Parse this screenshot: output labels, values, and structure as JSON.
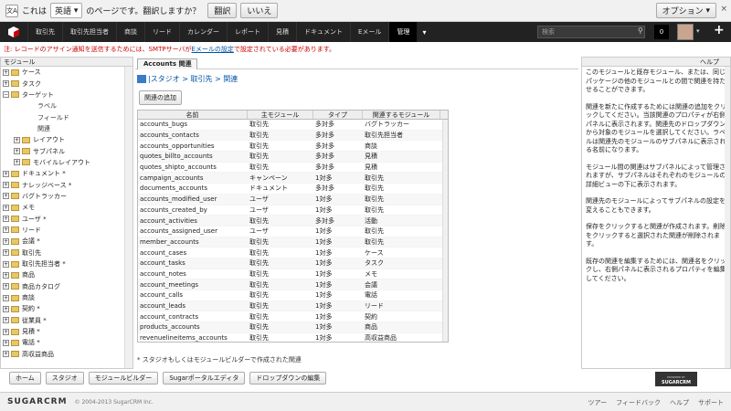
{
  "translate_bar": {
    "prefix": "これは",
    "language": "英語",
    "suffix": "のページです。翻訳しますか？",
    "translate_button": "翻訳",
    "no_button": "いいえ",
    "options_button": "オプション",
    "close": "×"
  },
  "nav": {
    "items": [
      "取引先",
      "取引先担当者",
      "商談",
      "リード",
      "カレンダー",
      "レポート",
      "見積",
      "ドキュメント",
      "Eメール",
      "管理"
    ],
    "active_index": 9,
    "more": "▾",
    "search_placeholder": "検索",
    "notifications": "0",
    "plus": "+"
  },
  "warning": {
    "before": "注: レコードのアサイン通知を送信するためには、SMTPサーバが",
    "link": "Eメールの設定",
    "after": "で設定されている必要があります。"
  },
  "left": {
    "title": "モジュール",
    "tree": [
      {
        "label": "ケース",
        "exp": "+",
        "indent": 0,
        "folder": true
      },
      {
        "label": "タスク",
        "exp": "+",
        "indent": 0,
        "folder": true
      },
      {
        "label": "ターゲット",
        "exp": "−",
        "indent": 0,
        "folder": true
      },
      {
        "label": "ラベル",
        "exp": "",
        "indent": 1,
        "folder": false
      },
      {
        "label": "フィールド",
        "exp": "",
        "indent": 1,
        "folder": false
      },
      {
        "label": "関連",
        "exp": "",
        "indent": 1,
        "folder": false
      },
      {
        "label": "レイアウト",
        "exp": "+",
        "indent": 1,
        "folder": true
      },
      {
        "label": "サブパネル",
        "exp": "+",
        "indent": 1,
        "folder": true
      },
      {
        "label": "モバイルレイアウト",
        "exp": "+",
        "indent": 1,
        "folder": true
      },
      {
        "label": "ドキュメント *",
        "exp": "+",
        "indent": 0,
        "folder": true
      },
      {
        "label": "ナレッジベース *",
        "exp": "+",
        "indent": 0,
        "folder": true
      },
      {
        "label": "バグトラッカー",
        "exp": "+",
        "indent": 0,
        "folder": true
      },
      {
        "label": "メモ",
        "exp": "+",
        "indent": 0,
        "folder": true
      },
      {
        "label": "ユーザ *",
        "exp": "+",
        "indent": 0,
        "folder": true
      },
      {
        "label": "リード",
        "exp": "+",
        "indent": 0,
        "folder": true
      },
      {
        "label": "会議 *",
        "exp": "+",
        "indent": 0,
        "folder": true
      },
      {
        "label": "取引先",
        "exp": "+",
        "indent": 0,
        "folder": true
      },
      {
        "label": "取引先担当者 *",
        "exp": "+",
        "indent": 0,
        "folder": true
      },
      {
        "label": "商品",
        "exp": "+",
        "indent": 0,
        "folder": true
      },
      {
        "label": "商品カタログ",
        "exp": "+",
        "indent": 0,
        "folder": true
      },
      {
        "label": "商談",
        "exp": "+",
        "indent": 0,
        "folder": true
      },
      {
        "label": "契約 *",
        "exp": "+",
        "indent": 0,
        "folder": true
      },
      {
        "label": "従業員 *",
        "exp": "+",
        "indent": 0,
        "folder": true
      },
      {
        "label": "見積 *",
        "exp": "+",
        "indent": 0,
        "folder": true
      },
      {
        "label": "電話 *",
        "exp": "+",
        "indent": 0,
        "folder": true
      },
      {
        "label": "高収益商品",
        "exp": "+",
        "indent": 0,
        "folder": true
      }
    ]
  },
  "center": {
    "tab": "Accounts 関連",
    "breadcrumb": "|スタジオ > 取引先 > 関連",
    "add_button": "関連の追加",
    "columns": [
      "名前",
      "主モジュール",
      "タイプ",
      "関連するモジュール"
    ],
    "rows": [
      [
        "accounts_bugs",
        "取引先",
        "多対多",
        "バグトラッカー"
      ],
      [
        "accounts_contacts",
        "取引先",
        "多対多",
        "取引先担当者"
      ],
      [
        "accounts_opportunities",
        "取引先",
        "多対多",
        "商談"
      ],
      [
        "quotes_billto_accounts",
        "取引先",
        "多対多",
        "見積"
      ],
      [
        "quotes_shipto_accounts",
        "取引先",
        "多対多",
        "見積"
      ],
      [
        "campaign_accounts",
        "キャンペーン",
        "1対多",
        "取引先"
      ],
      [
        "documents_accounts",
        "ドキュメント",
        "多対多",
        "取引先"
      ],
      [
        "accounts_modified_user",
        "ユーザ",
        "1対多",
        "取引先"
      ],
      [
        "accounts_created_by",
        "ユーザ",
        "1対多",
        "取引先"
      ],
      [
        "account_activities",
        "取引先",
        "多対多",
        "活動"
      ],
      [
        "accounts_assigned_user",
        "ユーザ",
        "1対多",
        "取引先"
      ],
      [
        "member_accounts",
        "取引先",
        "1対多",
        "取引先"
      ],
      [
        "account_cases",
        "取引先",
        "1対多",
        "ケース"
      ],
      [
        "account_tasks",
        "取引先",
        "1対多",
        "タスク"
      ],
      [
        "account_notes",
        "取引先",
        "1対多",
        "メモ"
      ],
      [
        "account_meetings",
        "取引先",
        "1対多",
        "会議"
      ],
      [
        "account_calls",
        "取引先",
        "1対多",
        "電話"
      ],
      [
        "account_leads",
        "取引先",
        "1対多",
        "リード"
      ],
      [
        "account_contracts",
        "取引先",
        "1対多",
        "契約"
      ],
      [
        "products_accounts",
        "取引先",
        "1対多",
        "商品"
      ],
      [
        "revenuelineitems_accounts",
        "取引先",
        "1対多",
        "高収益商品"
      ]
    ],
    "footnote": "* スタジオもしくはモジュールビルダーで作成された関連"
  },
  "help": {
    "title": "ヘルプ",
    "paragraphs": [
      "このモジュールと既存モジュール、または、同じパッケージの他のモジュールとの間で関連を持たせることができます。",
      "関連を新たに作成するためには関連の追加をクリックしてください。当該関連のプロパティが右側パネルに表示されます。関連先のドロップダウンから対象のモジュールを選択してください。ラベルは関連先のモジュールのサブパネルに表示される名前になります。",
      "モジュール間の関連はサブパネルによって管理されますが、サブパネルはそれぞれのモジュールの詳細ビューの下に表示されます。",
      "関連先のモジュールによってサブパネルの設定を変えることもできます。",
      "保存をクリックすると関連が作成されます。削除をクリックすると選択された関連が削除されます。",
      "既存の関連を編集するためには、関連名をクリックし、右側パネルに表示されるプロパティを編集してください。"
    ]
  },
  "bottom_buttons": [
    "ホーム",
    "スタジオ",
    "モジュールビルダー",
    "Sugarポータルエディタ",
    "ドロップダウンの編集"
  ],
  "powered": "POWERED BY SUGARCRM",
  "footer": {
    "logo": "SUGARCRM",
    "copyright": "© 2004-2013 SugarCRM Inc.",
    "links": [
      "ツアー",
      "フィードバック",
      "ヘルプ",
      "サポート"
    ]
  }
}
